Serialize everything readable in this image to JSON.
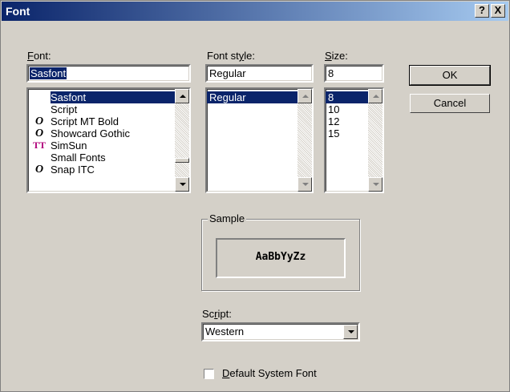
{
  "title": "Font",
  "title_buttons": {
    "help": "?",
    "close": "X"
  },
  "font": {
    "label": "Font:",
    "value": "Sasfont",
    "items": [
      {
        "name": "Sasfont",
        "icon": "",
        "selected": true
      },
      {
        "name": "Script",
        "icon": ""
      },
      {
        "name": "Script MT Bold",
        "icon": "O"
      },
      {
        "name": "Showcard Gothic",
        "icon": "O"
      },
      {
        "name": "SimSun",
        "icon": "TT"
      },
      {
        "name": "Small Fonts",
        "icon": ""
      },
      {
        "name": "Snap ITC",
        "icon": "O"
      }
    ]
  },
  "style": {
    "label": "Font style:",
    "value": "Regular",
    "items": [
      {
        "name": "Regular",
        "selected": true
      }
    ]
  },
  "size": {
    "label": "Size:",
    "value": "8",
    "items": [
      {
        "name": "8",
        "selected": true
      },
      {
        "name": "10"
      },
      {
        "name": "12"
      },
      {
        "name": "15"
      }
    ]
  },
  "buttons": {
    "ok": "OK",
    "cancel": "Cancel"
  },
  "sample": {
    "label": "Sample",
    "text": "AaBbYyZz"
  },
  "script": {
    "label": "Script:",
    "value": "Western"
  },
  "default_font": {
    "label": "Default System Font",
    "checked": false
  },
  "colors": {
    "selection": "#0a246a",
    "title_start": "#0a246a",
    "title_end": "#a6caf0",
    "face": "#d4d0c8",
    "truetype_icon": "#b0007a"
  }
}
